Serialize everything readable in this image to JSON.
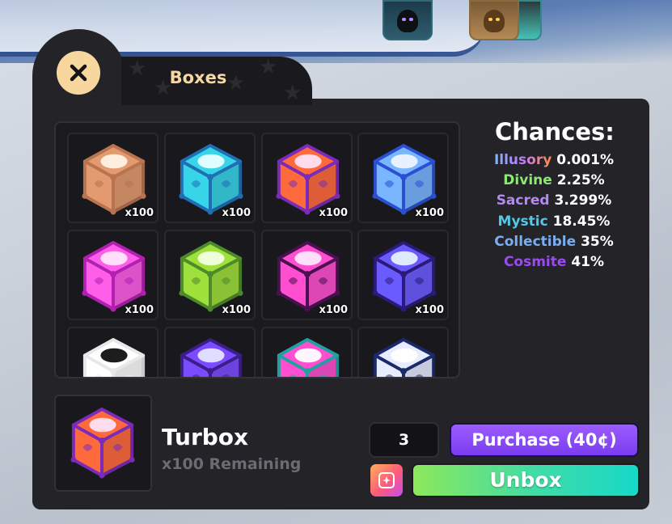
{
  "panel": {
    "tab_label": "Boxes",
    "close_icon": "close-icon"
  },
  "boxes": [
    {
      "name": "mystery-box",
      "count": "x100",
      "colors": [
        "#b8734f",
        "#e49a6f",
        "#fff2e6"
      ]
    },
    {
      "name": "lightning-box",
      "count": "x100",
      "colors": [
        "#1f6fb5",
        "#38d4e8",
        "#e8ffff"
      ]
    },
    {
      "name": "turbox",
      "count": "x100",
      "colors": [
        "#7b2bb8",
        "#ff6a3c",
        "#ffe2f6"
      ]
    },
    {
      "name": "wave-box",
      "count": "x100",
      "colors": [
        "#2a4fd1",
        "#79b6ff",
        "#eef6ff"
      ]
    },
    {
      "name": "signal-box",
      "count": "x100",
      "colors": [
        "#b21fb3",
        "#ff5ee8",
        "#ffe6fb"
      ]
    },
    {
      "name": "green-box",
      "count": "x100",
      "colors": [
        "#4d8a2a",
        "#9fe03a",
        "#f2ffe0"
      ]
    },
    {
      "name": "dark-pink-box",
      "count": "x100",
      "colors": [
        "#4a1050",
        "#ff4fd0",
        "#ffe6fb"
      ]
    },
    {
      "name": "galaxy-box",
      "count": "x100",
      "colors": [
        "#2b1a7a",
        "#6a5bff",
        "#e6f0ff"
      ]
    },
    {
      "name": "test-box",
      "count": "",
      "colors": [
        "#e8e8e8",
        "#ffffff",
        "#111111"
      ]
    },
    {
      "name": "void-box",
      "count": "",
      "colors": [
        "#3a1f8a",
        "#7b4cff",
        "#e6e6ff"
      ]
    },
    {
      "name": "prismatic-box",
      "count": "",
      "colors": [
        "#22a0a0",
        "#ff4fd0",
        "#ffffff"
      ]
    },
    {
      "name": "eye-box",
      "count": "",
      "colors": [
        "#1a2a6a",
        "#e8ecff",
        "#ffffff"
      ]
    }
  ],
  "chances": {
    "title": "Chances:",
    "rows": [
      {
        "rarity": "Illusory",
        "pct": "0.001%",
        "color": "gradient"
      },
      {
        "rarity": "Divine",
        "pct": "2.25%",
        "color": "#8ce873"
      },
      {
        "rarity": "Sacred",
        "pct": "3.299%",
        "color": "#b488f2"
      },
      {
        "rarity": "Mystic",
        "pct": "18.45%",
        "color": "#55c7e6"
      },
      {
        "rarity": "Collectible",
        "pct": "35%",
        "color": "#7aaef2"
      },
      {
        "rarity": "Cosmite",
        "pct": "41%",
        "color": "#9a4bf2"
      }
    ]
  },
  "selected": {
    "name": "Turbox",
    "remaining": "x100 Remaining"
  },
  "controls": {
    "quantity": "3",
    "purchase_label": "Purchase (40¢)",
    "auto_icon": "sparkle-icon",
    "unbox_label": "Unbox"
  }
}
